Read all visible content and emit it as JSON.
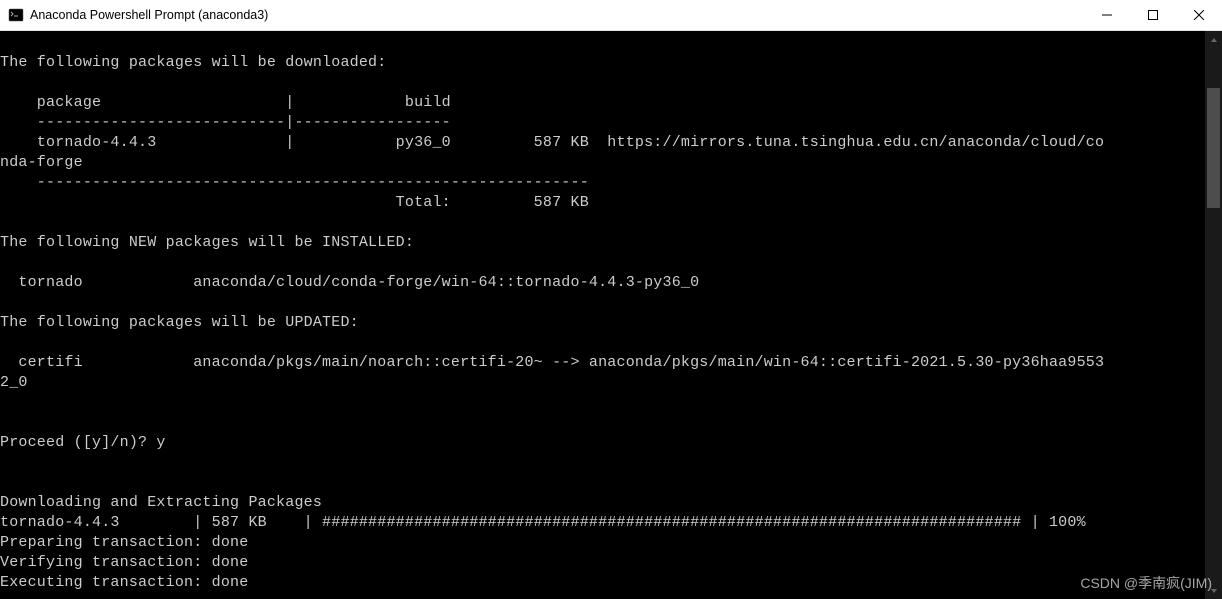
{
  "window": {
    "title": "Anaconda Powershell Prompt (anaconda3)"
  },
  "terminal": {
    "lines": [
      "",
      "The following packages will be downloaded:",
      "",
      "    package                    |            build",
      "    ---------------------------|-----------------",
      "    tornado-4.4.3              |           py36_0         587 KB  https://mirrors.tuna.tsinghua.edu.cn/anaconda/cloud/co",
      "nda-forge",
      "    ------------------------------------------------------------",
      "                                           Total:         587 KB",
      "",
      "The following NEW packages will be INSTALLED:",
      "",
      "  tornado            anaconda/cloud/conda-forge/win-64::tornado-4.4.3-py36_0",
      "",
      "The following packages will be UPDATED:",
      "",
      "  certifi            anaconda/pkgs/main/noarch::certifi-20~ --> anaconda/pkgs/main/win-64::certifi-2021.5.30-py36haa9553",
      "2_0",
      "",
      "",
      "Proceed ([y]/n)? y",
      "",
      "",
      "Downloading and Extracting Packages",
      "tornado-4.4.3        | 587 KB    | ############################################################################ | 100%",
      "Preparing transaction: done",
      "Verifying transaction: done",
      "Executing transaction: done"
    ]
  },
  "downloads": {
    "header_package": "package",
    "header_build": "build",
    "rows": [
      {
        "package": "tornado-4.4.3",
        "build": "py36_0",
        "size": "587 KB",
        "channel": "https://mirrors.tuna.tsinghua.edu.cn/anaconda/cloud/conda-forge"
      }
    ],
    "total_label": "Total:",
    "total_size": "587 KB"
  },
  "new_packages": [
    {
      "name": "tornado",
      "spec": "anaconda/cloud/conda-forge/win-64::tornado-4.4.3-py36_0"
    }
  ],
  "updated_packages": [
    {
      "name": "certifi",
      "from": "anaconda/pkgs/main/noarch::certifi-20~",
      "to": "anaconda/pkgs/main/win-64::certifi-2021.5.30-py36haa95532_0"
    }
  ],
  "prompt": {
    "question": "Proceed ([y]/n)?",
    "answer": "y"
  },
  "progress": [
    {
      "name": "tornado-4.4.3",
      "size": "587 KB",
      "bar": "############################################################################",
      "percent": "100%"
    }
  ],
  "transactions": [
    {
      "stage": "Preparing transaction",
      "status": "done"
    },
    {
      "stage": "Verifying transaction",
      "status": "done"
    },
    {
      "stage": "Executing transaction",
      "status": "done"
    }
  ],
  "watermark": "CSDN @季南疯(JIM)"
}
